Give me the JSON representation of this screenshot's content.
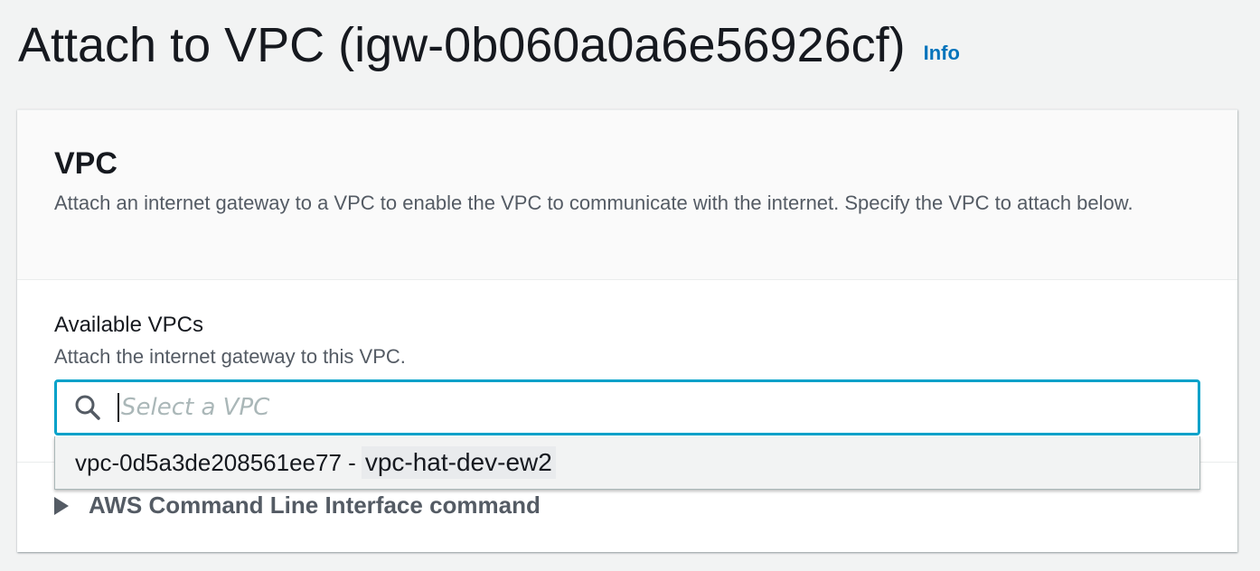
{
  "header": {
    "title": "Attach to VPC (igw-0b060a0a6e56926cf)",
    "info_label": "Info"
  },
  "vpc_section": {
    "title": "VPC",
    "description": "Attach an internet gateway to a VPC to enable the VPC to communicate with the internet. Specify the VPC to attach below."
  },
  "available_vpcs": {
    "label": "Available VPCs",
    "description": "Attach the internet gateway to this VPC.",
    "search": {
      "placeholder": "Select a VPC",
      "value": "",
      "icon": "search-icon"
    },
    "options": [
      {
        "id_text": "vpc-0d5a3de208561ee77 -",
        "name": "vpc-hat-dev-ew2"
      }
    ]
  },
  "cli_section": {
    "label": "AWS Command Line Interface command",
    "icon": "caret-right-icon"
  },
  "colors": {
    "accent": "#0073bb",
    "focus_border": "#00a1c9",
    "background": "#f2f3f3"
  }
}
